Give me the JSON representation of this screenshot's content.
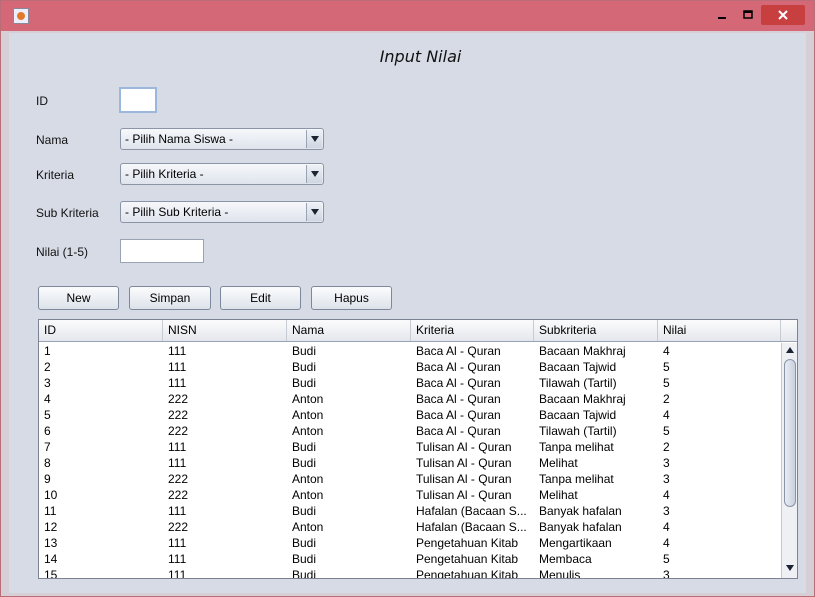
{
  "window": {
    "title": ""
  },
  "form": {
    "title": "Input Nilai",
    "id_label": "ID",
    "id_value": "",
    "nama_label": "Nama",
    "nama_selected": "- Pilih Nama Siswa -",
    "kriteria_label": "Kriteria",
    "kriteria_selected": "- Pilih Kriteria -",
    "subkriteria_label": "Sub Kriteria",
    "subkriteria_selected": "- Pilih Sub Kriteria -",
    "nilai_label": "Nilai (1-5)",
    "nilai_value": ""
  },
  "buttons": {
    "new": "New",
    "simpan": "Simpan",
    "edit": "Edit",
    "hapus": "Hapus"
  },
  "table": {
    "columns": [
      "ID",
      "NISN",
      "Nama",
      "Kriteria",
      "Subkriteria",
      "Nilai"
    ],
    "rows": [
      [
        "1",
        "111",
        "Budi",
        "Baca Al - Quran",
        "Bacaan Makhraj",
        "4"
      ],
      [
        "2",
        "111",
        "Budi",
        "Baca Al - Quran",
        "Bacaan Tajwid",
        "5"
      ],
      [
        "3",
        "111",
        "Budi",
        "Baca Al - Quran",
        "Tilawah (Tartil)",
        "5"
      ],
      [
        "4",
        "222",
        "Anton",
        "Baca Al - Quran",
        "Bacaan Makhraj",
        "2"
      ],
      [
        "5",
        "222",
        "Anton",
        "Baca Al - Quran",
        "Bacaan Tajwid",
        "4"
      ],
      [
        "6",
        "222",
        "Anton",
        "Baca Al - Quran",
        "Tilawah (Tartil)",
        "5"
      ],
      [
        "7",
        "111",
        "Budi",
        "Tulisan Al - Quran",
        "Tanpa melihat",
        "2"
      ],
      [
        "8",
        "111",
        "Budi",
        "Tulisan Al - Quran",
        "Melihat",
        "3"
      ],
      [
        "9",
        "222",
        "Anton",
        "Tulisan Al - Quran",
        "Tanpa melihat",
        "3"
      ],
      [
        "10",
        "222",
        "Anton",
        "Tulisan Al - Quran",
        "Melihat",
        "4"
      ],
      [
        "11",
        "111",
        "Budi",
        "Hafalan (Bacaan S...",
        "Banyak hafalan",
        "3"
      ],
      [
        "12",
        "222",
        "Anton",
        "Hafalan (Bacaan S...",
        "Banyak hafalan",
        "4"
      ],
      [
        "13",
        "111",
        "Budi",
        "Pengetahuan Kitab",
        "Mengartikaan",
        "4"
      ],
      [
        "14",
        "111",
        "Budi",
        "Pengetahuan Kitab",
        "Membaca",
        "5"
      ],
      [
        "15",
        "111",
        "Budi",
        "Pengetahuan Kitab",
        "Menulis",
        "3"
      ]
    ]
  },
  "icons": {
    "app": "java-app-icon",
    "minimize": "minimize-icon",
    "maximize": "maximize-icon",
    "close": "close-icon",
    "dropdown": "chevron-down-icon"
  },
  "colors": {
    "titlebar": "#d46876",
    "close_button": "#c7403f",
    "panel": "#d7dbe6"
  }
}
